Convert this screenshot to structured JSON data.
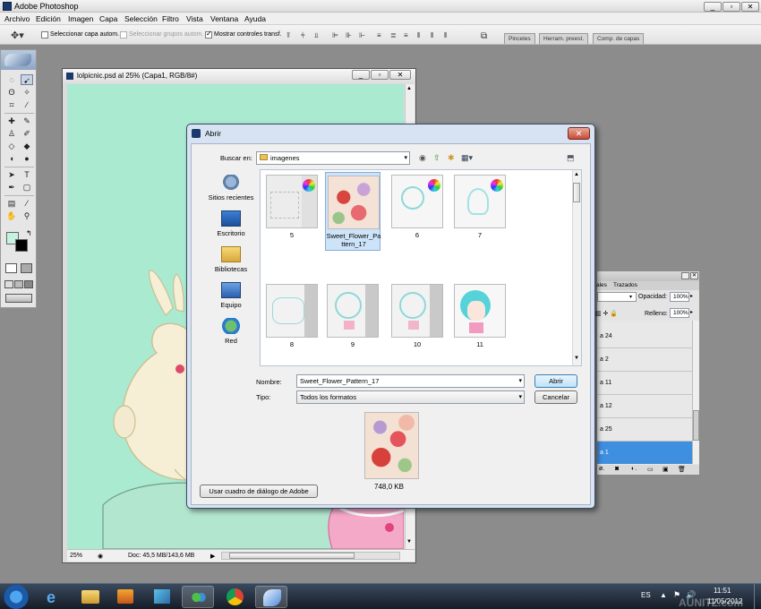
{
  "app": {
    "title": "Adobe Photoshop",
    "window_controls": [
      "_",
      "▫",
      "✕"
    ]
  },
  "menu": [
    "Archivo",
    "Edición",
    "Imagen",
    "Capa",
    "Selección",
    "Filtro",
    "Vista",
    "Ventana",
    "Ayuda"
  ],
  "options_bar": {
    "auto_select_layer": {
      "label": "Seleccionar capa autom.",
      "checked": false
    },
    "auto_select_groups": {
      "label": "Seleccionar grupos autom.",
      "checked": false,
      "disabled": true
    },
    "show_transform": {
      "label": "Mostrar controles transf.",
      "checked": true
    },
    "panel_tabs": [
      "Pinceles",
      "Herram. preest.",
      "Comp. de capas"
    ]
  },
  "document": {
    "title": "lolpicnic.psd al 25% (Capa1, RGB/8#)",
    "zoom": "25%",
    "doc_size": "Doc: 45,5 MB/143,6 MB",
    "canvas_color": "#a9ead1"
  },
  "layers_panel": {
    "opacity_label": "Opacidad:",
    "opacity_value": "100%",
    "fill_label": "Relleno:",
    "fill_value": "100%",
    "layers": [
      "a 24",
      "a 2",
      "a 11",
      "a 12",
      "a 25",
      "a 1"
    ],
    "selected_index": 5
  },
  "dialog": {
    "title": "Abrir",
    "look_in_label": "Buscar en:",
    "look_in_value": "imagenes",
    "places": [
      {
        "label": "Sitios recientes",
        "icon": "recent-places-icon"
      },
      {
        "label": "Escritorio",
        "icon": "desktop-icon"
      },
      {
        "label": "Bibliotecas",
        "icon": "libraries-icon"
      },
      {
        "label": "Equipo",
        "icon": "computer-icon"
      },
      {
        "label": "Red",
        "icon": "network-icon"
      }
    ],
    "files": [
      {
        "label": "5",
        "selected": false
      },
      {
        "label": "Sweet_Flower_Pattern_17",
        "selected": true
      },
      {
        "label": "6",
        "selected": false
      },
      {
        "label": "7",
        "selected": false
      },
      {
        "label": "8",
        "selected": false
      },
      {
        "label": "9",
        "selected": false
      },
      {
        "label": "10",
        "selected": false
      },
      {
        "label": "11",
        "selected": false
      }
    ],
    "name_label": "Nombre:",
    "name_value": "Sweet_Flower_Pattern_17",
    "type_label": "Tipo:",
    "type_value": "Todos los formatos",
    "open_button": "Abrir",
    "cancel_button": "Cancelar",
    "adobe_dialog_button": "Usar cuadro de diálogo de Adobe",
    "preview_size": "748,0 KB"
  },
  "taskbar": {
    "language": "ES",
    "time": "11:51",
    "date": "11/05/2012",
    "watermark": "AUNITZ.com"
  }
}
